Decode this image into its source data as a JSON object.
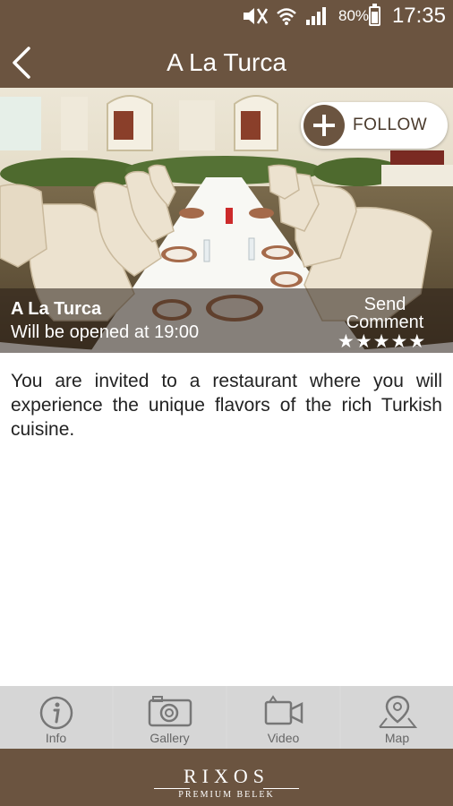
{
  "status_bar": {
    "battery": "80%",
    "time": "17:35",
    "icons": [
      "mute-icon",
      "wifi-icon",
      "signal-icon",
      "battery-charging-icon"
    ]
  },
  "header": {
    "title": "A La Turca",
    "back_icon": "chevron-left-icon"
  },
  "hero": {
    "follow_label": "FOLLOW",
    "follow_icon": "plus-circle-icon",
    "venue_name": "A La Turca",
    "opening": "Will be opened at 19:00",
    "send_comment": "Send Comment",
    "rating": {
      "value": 5,
      "max": 5,
      "star": "★"
    }
  },
  "description": "You are invited to a restaurant where you will experience the unique flavors of the rich Turkish cuisine.",
  "tabs": [
    {
      "label": "Info",
      "icon": "info-icon"
    },
    {
      "label": "Gallery",
      "icon": "camera-icon"
    },
    {
      "label": "Video",
      "icon": "video-camera-icon"
    },
    {
      "label": "Map",
      "icon": "map-pin-icon"
    }
  ],
  "footer": {
    "brand": "RIXOS",
    "subtitle": "PREMIUM BELEK"
  },
  "colors": {
    "brand_brown": "#6b5440",
    "tab_bg": "#d6d6d6",
    "text": "#222222"
  }
}
